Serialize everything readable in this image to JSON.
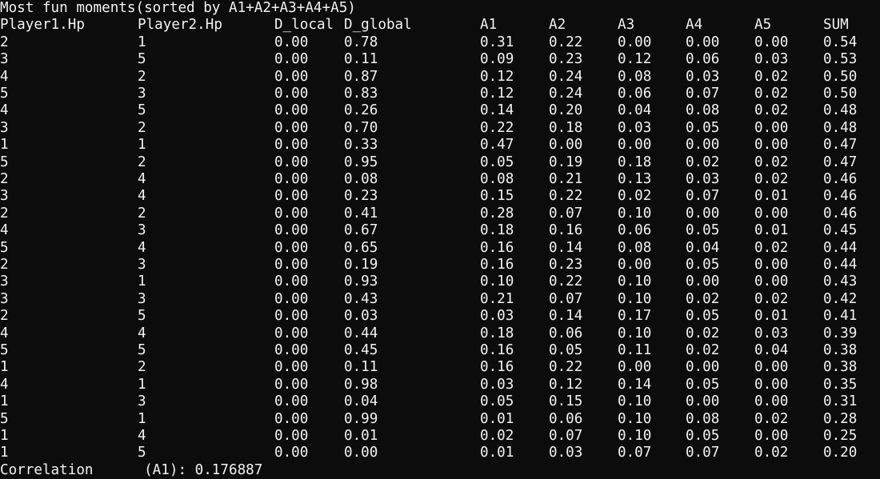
{
  "title": "Most fun moments(sorted by A1+A2+A3+A4+A5)",
  "columns": [
    "Player1.Hp",
    "Player2.Hp",
    "D_local",
    "D_global",
    "A1",
    "A2",
    "A3",
    "A4",
    "A5",
    "SUM"
  ],
  "rows": [
    [
      "2",
      "1",
      "0.00",
      "0.78",
      "0.31",
      "0.22",
      "0.00",
      "0.00",
      "0.00",
      "0.54"
    ],
    [
      "3",
      "5",
      "0.00",
      "0.11",
      "0.09",
      "0.23",
      "0.12",
      "0.06",
      "0.03",
      "0.53"
    ],
    [
      "4",
      "2",
      "0.00",
      "0.87",
      "0.12",
      "0.24",
      "0.08",
      "0.03",
      "0.02",
      "0.50"
    ],
    [
      "5",
      "3",
      "0.00",
      "0.83",
      "0.12",
      "0.24",
      "0.06",
      "0.07",
      "0.02",
      "0.50"
    ],
    [
      "4",
      "5",
      "0.00",
      "0.26",
      "0.14",
      "0.20",
      "0.04",
      "0.08",
      "0.02",
      "0.48"
    ],
    [
      "3",
      "2",
      "0.00",
      "0.70",
      "0.22",
      "0.18",
      "0.03",
      "0.05",
      "0.00",
      "0.48"
    ],
    [
      "1",
      "1",
      "0.00",
      "0.33",
      "0.47",
      "0.00",
      "0.00",
      "0.00",
      "0.00",
      "0.47"
    ],
    [
      "5",
      "2",
      "0.00",
      "0.95",
      "0.05",
      "0.19",
      "0.18",
      "0.02",
      "0.02",
      "0.47"
    ],
    [
      "2",
      "4",
      "0.00",
      "0.08",
      "0.08",
      "0.21",
      "0.13",
      "0.03",
      "0.02",
      "0.46"
    ],
    [
      "3",
      "4",
      "0.00",
      "0.23",
      "0.15",
      "0.22",
      "0.02",
      "0.07",
      "0.01",
      "0.46"
    ],
    [
      "2",
      "2",
      "0.00",
      "0.41",
      "0.28",
      "0.07",
      "0.10",
      "0.00",
      "0.00",
      "0.46"
    ],
    [
      "4",
      "3",
      "0.00",
      "0.67",
      "0.18",
      "0.16",
      "0.06",
      "0.05",
      "0.01",
      "0.45"
    ],
    [
      "5",
      "4",
      "0.00",
      "0.65",
      "0.16",
      "0.14",
      "0.08",
      "0.04",
      "0.02",
      "0.44"
    ],
    [
      "2",
      "3",
      "0.00",
      "0.19",
      "0.16",
      "0.23",
      "0.00",
      "0.05",
      "0.00",
      "0.44"
    ],
    [
      "3",
      "1",
      "0.00",
      "0.93",
      "0.10",
      "0.22",
      "0.10",
      "0.00",
      "0.00",
      "0.43"
    ],
    [
      "3",
      "3",
      "0.00",
      "0.43",
      "0.21",
      "0.07",
      "0.10",
      "0.02",
      "0.02",
      "0.42"
    ],
    [
      "2",
      "5",
      "0.00",
      "0.03",
      "0.03",
      "0.14",
      "0.17",
      "0.05",
      "0.01",
      "0.41"
    ],
    [
      "4",
      "4",
      "0.00",
      "0.44",
      "0.18",
      "0.06",
      "0.10",
      "0.02",
      "0.03",
      "0.39"
    ],
    [
      "5",
      "5",
      "0.00",
      "0.45",
      "0.16",
      "0.05",
      "0.11",
      "0.02",
      "0.04",
      "0.38"
    ],
    [
      "1",
      "2",
      "0.00",
      "0.11",
      "0.16",
      "0.22",
      "0.00",
      "0.00",
      "0.00",
      "0.38"
    ],
    [
      "4",
      "1",
      "0.00",
      "0.98",
      "0.03",
      "0.12",
      "0.14",
      "0.05",
      "0.00",
      "0.35"
    ],
    [
      "1",
      "3",
      "0.00",
      "0.04",
      "0.05",
      "0.15",
      "0.10",
      "0.00",
      "0.00",
      "0.31"
    ],
    [
      "5",
      "1",
      "0.00",
      "0.99",
      "0.01",
      "0.06",
      "0.10",
      "0.08",
      "0.02",
      "0.28"
    ],
    [
      "1",
      "4",
      "0.00",
      "0.01",
      "0.02",
      "0.07",
      "0.10",
      "0.05",
      "0.00",
      "0.25"
    ],
    [
      "1",
      "5",
      "0.00",
      "0.00",
      "0.01",
      "0.03",
      "0.07",
      "0.07",
      "0.02",
      "0.20"
    ]
  ],
  "footer": "Correlation      (A1): 0.176887"
}
